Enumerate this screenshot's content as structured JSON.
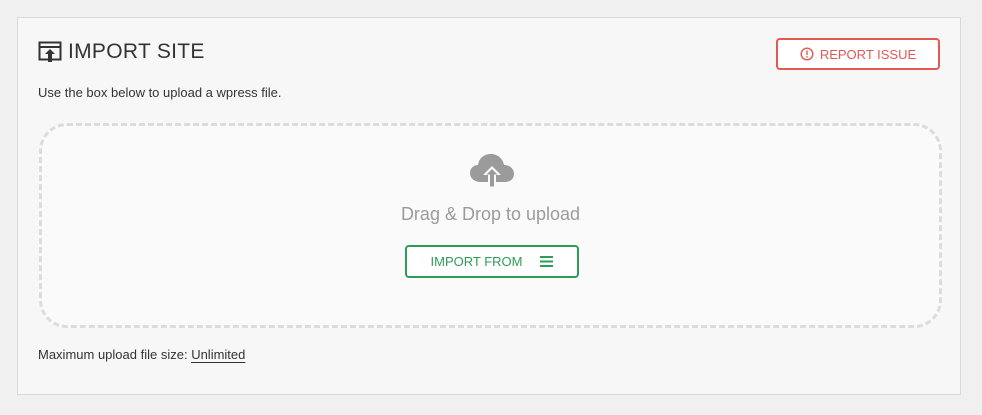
{
  "header": {
    "title": "IMPORT SITE",
    "title_icon": "import-site-icon",
    "report_label": "REPORT ISSUE",
    "report_icon": "exclamation-circle-icon"
  },
  "description": "Use the box below to upload a wpress file.",
  "dropzone": {
    "icon": "cloud-upload-icon",
    "text": "Drag & Drop to upload",
    "import_label": "IMPORT FROM",
    "import_icon": "menu-icon"
  },
  "footer": {
    "label": "Maximum upload file size:",
    "value": "Unlimited"
  },
  "colors": {
    "report": "#e05a52",
    "import": "#2e9c59",
    "muted": "#9b9b9b"
  }
}
